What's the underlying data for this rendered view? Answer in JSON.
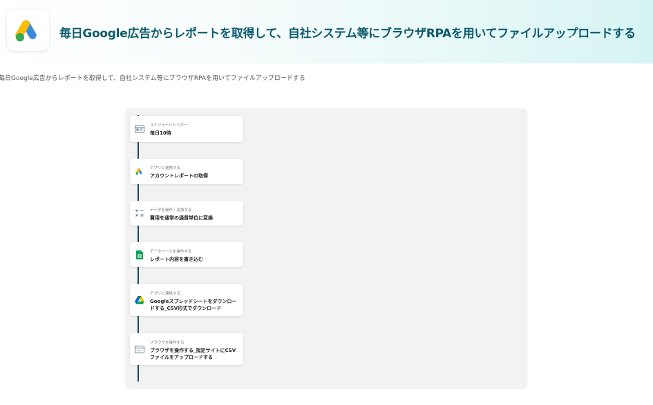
{
  "header": {
    "title": "毎日Google広告からレポートを取得して、自社システム等にブラウザRPAを用いてファイルアップロードする",
    "app_icon": "google-ads-icon",
    "colors": {
      "title": "#0d5a6b",
      "gradient_end": "#d6f4f3"
    }
  },
  "subtitle": "毎日Google広告からレポートを取得して、自社システム等にブラウザRPAを用いてファイルアップロードする",
  "flow": {
    "steps": [
      {
        "category": "スケジュールトリガー",
        "title": "毎日10時",
        "icon": "schedule-icon"
      },
      {
        "category": "アプリと連携する",
        "title": "アカウントレポートの取得",
        "icon": "google-ads-icon"
      },
      {
        "category": "データを操作・変換する",
        "title": "費用を通常の通貨単位に変換",
        "icon": "calculator-icon"
      },
      {
        "category": "データベースを操作する",
        "title": "レポート内容を書き込む",
        "icon": "google-sheets-icon"
      },
      {
        "category": "アプリと連携する",
        "title": "Googleスプレッドシートをダウンロードする_CSV形式でダウンロード",
        "icon": "google-drive-icon"
      },
      {
        "category": "ブラウザを操作する",
        "title": "ブラウザを操作する_指定サイトにCSVファイルをアップロードする",
        "icon": "browser-icon"
      }
    ]
  }
}
